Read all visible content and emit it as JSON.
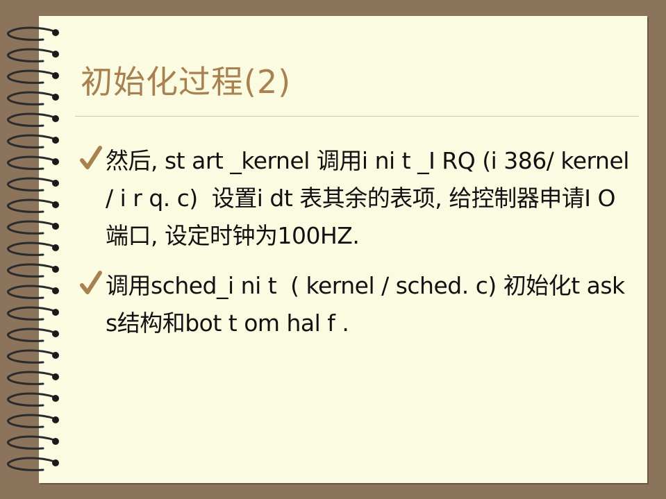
{
  "slide": {
    "title": "初始化过程(2)",
    "bullets": [
      {
        "icon": "checkmark-icon",
        "text": "然后, st art _kernel 调用i ni t _I RQ (i 386/ kernel / i r q. c)  设置i dt 表其余的表项, 给控制器申请I O端口, 设定时钟为100HZ."
      },
      {
        "icon": "checkmark-icon",
        "text": "调用sched_i ni t  ( kernel / sched. c) 初始化t asks结构和bot t om hal f ."
      }
    ]
  },
  "colors": {
    "background": "#8c735c",
    "page": "#fbfbe2",
    "title": "#a9804f",
    "check": "#a9804f",
    "rule": "#cfc6ad",
    "text": "#111111"
  }
}
